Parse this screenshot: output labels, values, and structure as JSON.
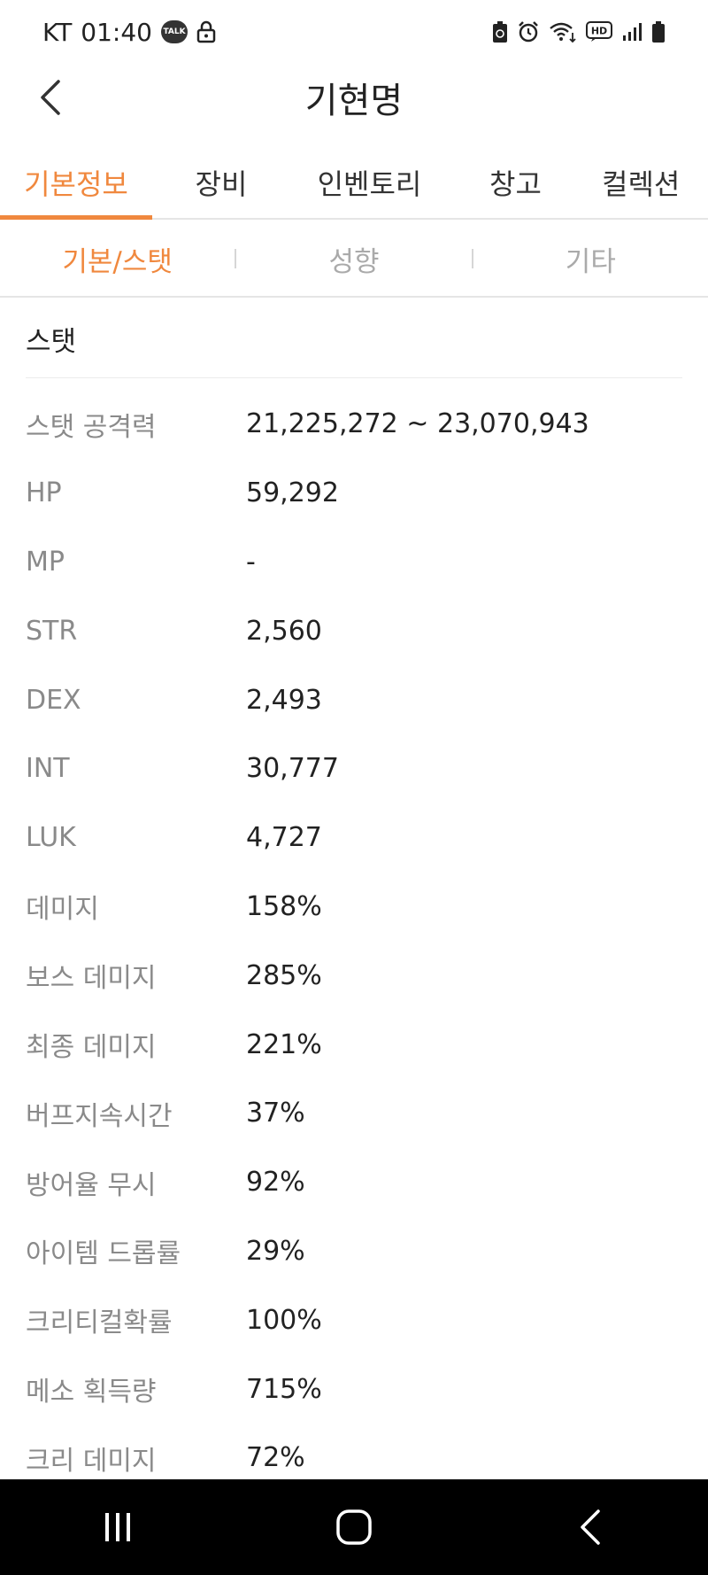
{
  "status_bar": {
    "carrier": "KT",
    "time": "01:40",
    "talk_badge": "TALK",
    "hd_badge": "HD"
  },
  "header": {
    "title": "기현명"
  },
  "tabs": [
    {
      "label": "기본정보",
      "active": true
    },
    {
      "label": "장비",
      "active": false
    },
    {
      "label": "인벤토리",
      "active": false
    },
    {
      "label": "창고",
      "active": false
    },
    {
      "label": "컬렉션",
      "active": false
    }
  ],
  "subtabs": [
    {
      "label": "기본/스탯",
      "active": true
    },
    {
      "label": "성향",
      "active": false
    },
    {
      "label": "기타",
      "active": false
    }
  ],
  "section": {
    "title": "스탯"
  },
  "stats": [
    {
      "label": "스탯 공격력",
      "value": "21,225,272 ~ 23,070,943"
    },
    {
      "label": "HP",
      "value": "59,292"
    },
    {
      "label": "MP",
      "value": "-"
    },
    {
      "label": "STR",
      "value": "2,560"
    },
    {
      "label": "DEX",
      "value": "2,493"
    },
    {
      "label": "INT",
      "value": "30,777"
    },
    {
      "label": "LUK",
      "value": "4,727"
    },
    {
      "label": "데미지",
      "value": "158%"
    },
    {
      "label": "보스 데미지",
      "value": "285%"
    },
    {
      "label": "최종 데미지",
      "value": "221%"
    },
    {
      "label": "버프지속시간",
      "value": "37%"
    },
    {
      "label": "방어율 무시",
      "value": "92%"
    },
    {
      "label": "아이템 드롭률",
      "value": "29%"
    },
    {
      "label": "크리티컬확률",
      "value": "100%"
    },
    {
      "label": "메소 획득량",
      "value": "715%"
    },
    {
      "label": "크리 데미지",
      "value": "72%"
    }
  ],
  "colors": {
    "accent": "#f0883e",
    "label_gray": "#8a8a8a",
    "divider": "#e5e5e5"
  }
}
